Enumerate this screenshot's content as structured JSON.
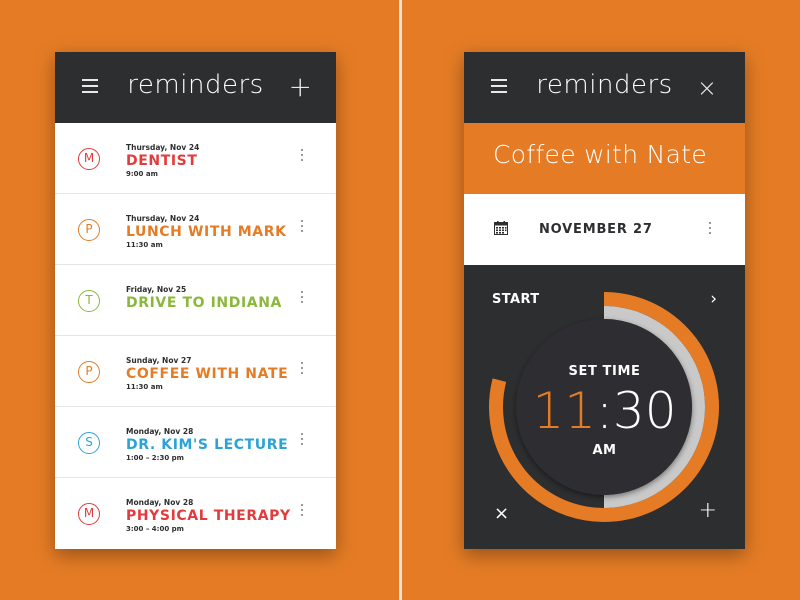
{
  "left_app": {
    "title": "reminders",
    "add_label": "+",
    "items": [
      {
        "initial": "M",
        "date": "Thursday, Nov 24",
        "name": "DENTIST",
        "time": "9:00 am",
        "color": "#e23b3b"
      },
      {
        "initial": "P",
        "date": "Thursday, Nov 24",
        "name": "LUNCH WITH MARK",
        "time": "11:30 am",
        "color": "#e57c25"
      },
      {
        "initial": "T",
        "date": "Friday, Nov 25",
        "name": "DRIVE TO INDIANA",
        "time": "",
        "color": "#8ab83a"
      },
      {
        "initial": "P",
        "date": "Sunday, Nov 27",
        "name": "COFFEE WITH NATE",
        "time": "11:30 am",
        "color": "#e57c25"
      },
      {
        "initial": "S",
        "date": "Monday, Nov 28",
        "name": "DR. KIM'S LECTURE",
        "time": "1:00 – 2:30 pm",
        "color": "#2ba3d8"
      },
      {
        "initial": "M",
        "date": "Monday, Nov 28",
        "name": "PHYSICAL THERAPY",
        "time": "3:00 – 4:00 pm",
        "color": "#e23b3b"
      }
    ]
  },
  "right_app": {
    "title": "reminders",
    "close_label": "×",
    "event_title": "Coffee with Nate",
    "date_label": "NOVEMBER 27",
    "start_label": "START",
    "next_label": "›",
    "set_time_label": "SET TIME",
    "hour": "11",
    "separator": ":",
    "minute": "30",
    "ampm": "AM",
    "minus_label": "×",
    "plus_label": "+",
    "dial_progress": 0.79
  },
  "colors": {
    "accent": "#e57c25",
    "dark": "#2d2e30",
    "background": "#e57c25"
  },
  "icons": {
    "menu": "hamburger-icon",
    "calendar": "calendar-icon",
    "more": "kebab-icon"
  }
}
